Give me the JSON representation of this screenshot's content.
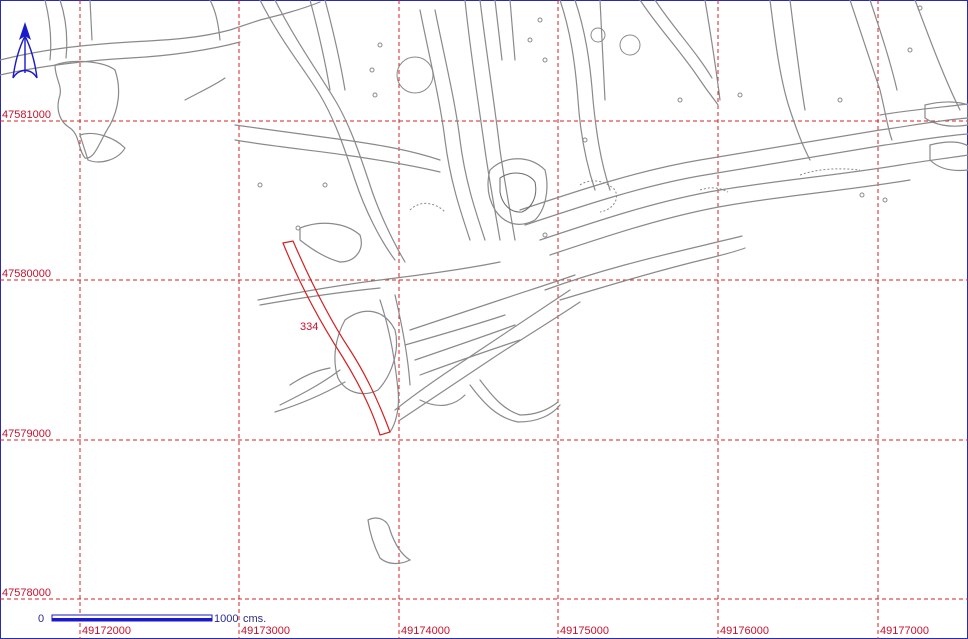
{
  "map": {
    "grid_x_labels": [
      "49172000",
      "49173000",
      "49174000",
      "49175000",
      "49176000",
      "49177000"
    ],
    "grid_y_labels": [
      "47581000",
      "47580000",
      "47579000",
      "47578000"
    ],
    "highlight_label": "334",
    "scale": {
      "start_label": "0",
      "end_label": "1000",
      "unit_label": "cms."
    },
    "colors": {
      "grid": "#d42020",
      "features": "#8a8a8a",
      "highlight": "#d42020",
      "north_arrow": "#1a1ac8",
      "frame": "#2b2bb0"
    },
    "north_arrow_icon": "north-arrow-icon"
  }
}
